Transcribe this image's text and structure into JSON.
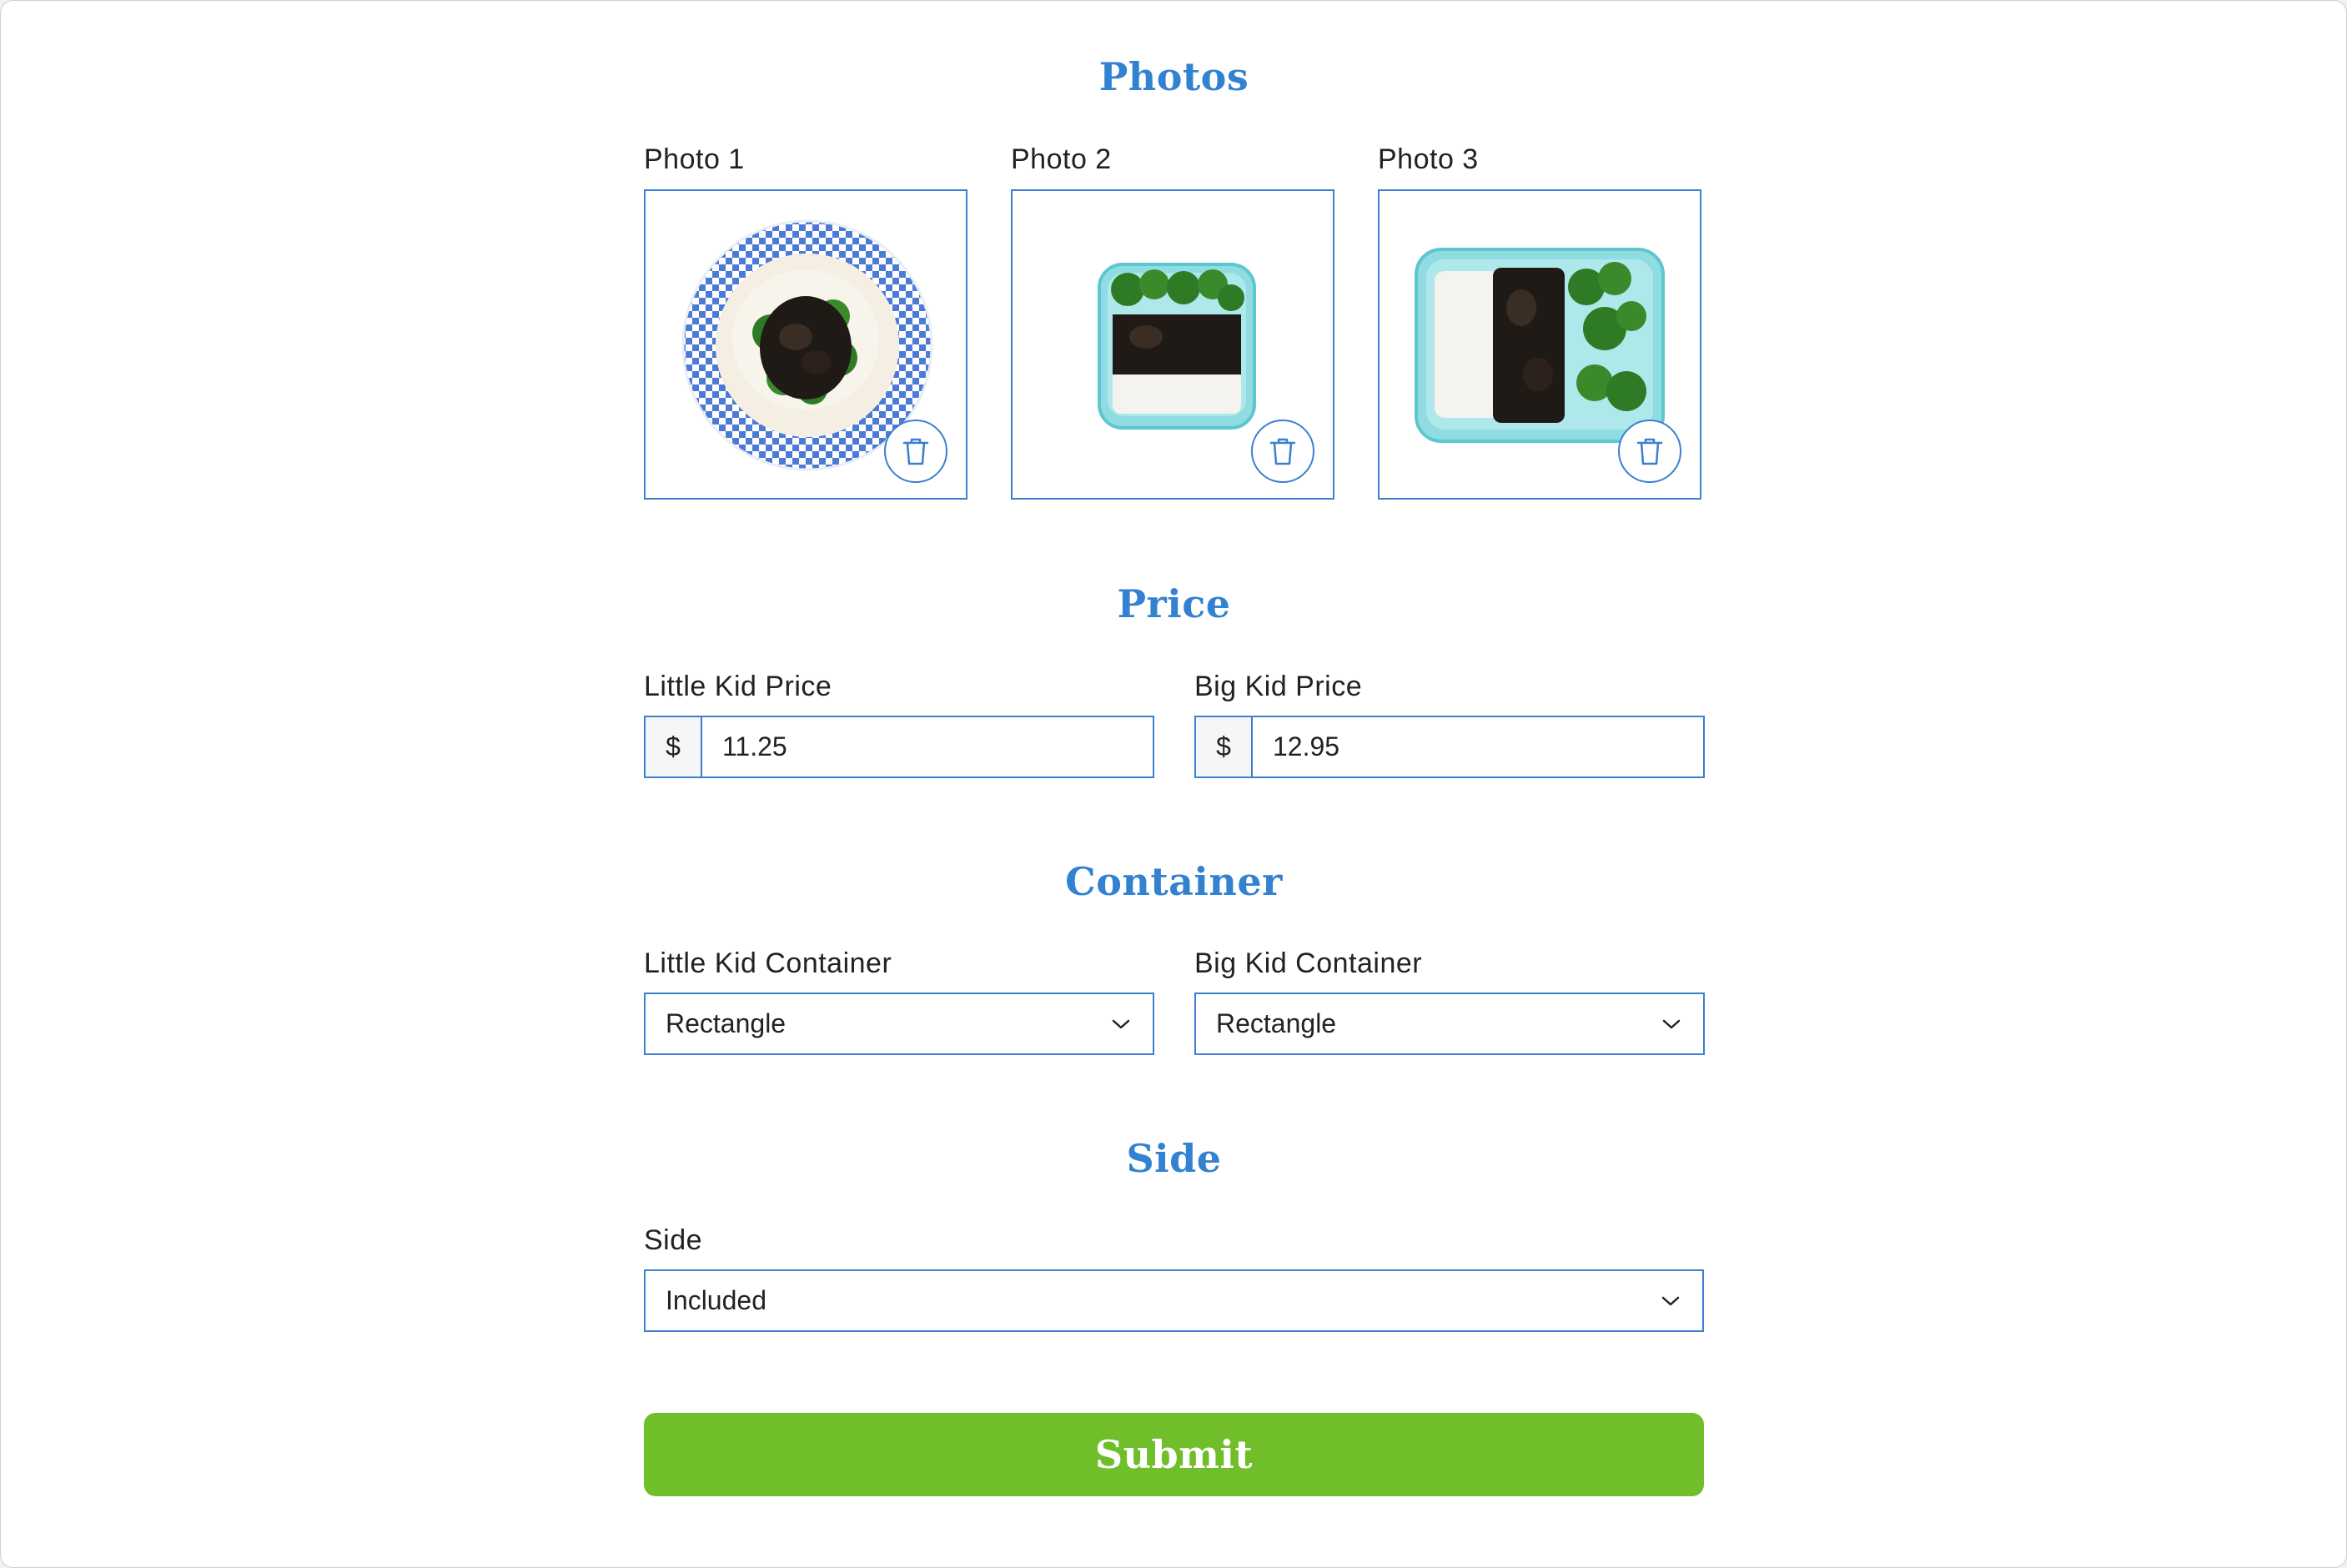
{
  "sections": {
    "photos": {
      "title": "Photos",
      "items": [
        {
          "label": "Photo 1",
          "image": "rice-broccoli-checkered-plate"
        },
        {
          "label": "Photo 2",
          "image": "rice-broccoli-square-container"
        },
        {
          "label": "Photo 3",
          "image": "rice-broccoli-rectangle-container"
        }
      ],
      "delete_icon": "trash-icon"
    },
    "price": {
      "title": "Price",
      "little_kid": {
        "label": "Little Kid Price",
        "prefix": "$",
        "value": "11.25"
      },
      "big_kid": {
        "label": "Big Kid Price",
        "prefix": "$",
        "value": "12.95"
      }
    },
    "container": {
      "title": "Container",
      "little_kid": {
        "label": "Little Kid Container",
        "value": "Rectangle"
      },
      "big_kid": {
        "label": "Big Kid Container",
        "value": "Rectangle"
      }
    },
    "side": {
      "title": "Side",
      "label": "Side",
      "value": "Included"
    }
  },
  "submit_label": "Submit",
  "colors": {
    "accent": "#3282d1",
    "border": "#3a7fd0",
    "submit": "#6fbe2a"
  }
}
